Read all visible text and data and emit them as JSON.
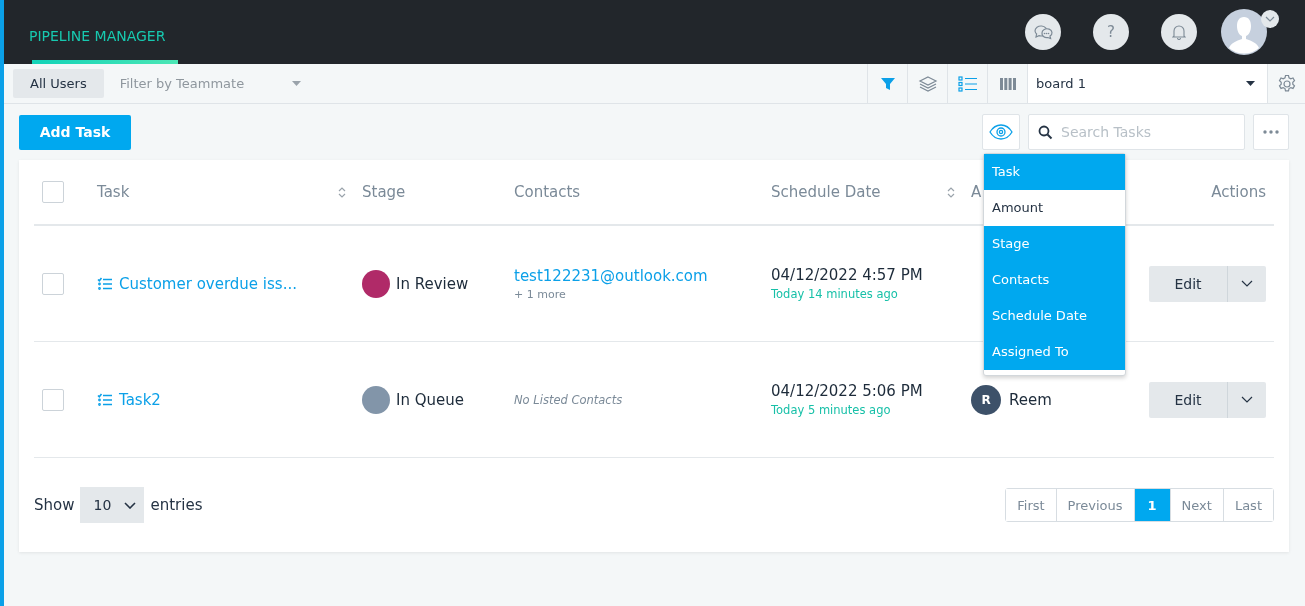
{
  "app": {
    "title": "PIPELINE MANAGER"
  },
  "header_buttons": [
    {
      "kind": "chat"
    },
    {
      "kind": "help",
      "label": "?"
    },
    {
      "kind": "bell"
    }
  ],
  "toolbar": {
    "tabs": [
      {
        "label": "All Users",
        "selected": true
      }
    ],
    "filter": {
      "placeholder": "Filter by Teammate"
    },
    "views": [
      {
        "kind": "filter",
        "selected": true
      },
      {
        "kind": "layers",
        "selected": false
      },
      {
        "kind": "list",
        "selected": true
      },
      {
        "kind": "columns",
        "selected": false
      }
    ],
    "board": {
      "value": "board 1"
    }
  },
  "add_button": "Add Task",
  "search": {
    "placeholder": "Search Tasks"
  },
  "column_menu": [
    {
      "label": "Task",
      "selected": true
    },
    {
      "label": "Amount",
      "selected": false
    },
    {
      "label": "Stage",
      "selected": true
    },
    {
      "label": "Contacts",
      "selected": true
    },
    {
      "label": "Schedule Date",
      "selected": true
    },
    {
      "label": "Assigned To",
      "selected": true
    }
  ],
  "table": {
    "select_all": {
      "checked": false
    },
    "columns": [
      {
        "label": "Task",
        "sortable": true
      },
      {
        "label": "Stage",
        "sortable": false
      },
      {
        "label": "Contacts",
        "sortable": false
      },
      {
        "label": "Schedule Date",
        "sortable": true
      },
      {
        "label": "A",
        "sortable": false
      },
      {
        "label": "Actions",
        "sortable": false
      }
    ],
    "rows": [
      {
        "checked": false,
        "task": "Customer overdue iss...",
        "stage": "In Review",
        "color": "#b02a68",
        "contact": "test122231@outlook.com",
        "contact_more": "+ 1 more",
        "date": "04/12/2022 4:57 PM",
        "ago": "Today 14 minutes ago",
        "action": "Edit"
      },
      {
        "checked": false,
        "task": "Task2",
        "stage": "In Queue",
        "color": "#8295a9",
        "no_contacts": "No Listed Contacts",
        "date": "04/12/2022 5:06 PM",
        "ago": "Today 5 minutes ago",
        "assignee": {
          "initial": "R",
          "name": "Reem"
        },
        "action": "Edit"
      }
    ]
  },
  "footer": {
    "show": "Show",
    "page_size": "10",
    "entries": "entries",
    "pagination": [
      {
        "label": "First",
        "selected": false
      },
      {
        "label": "Previous",
        "selected": false
      },
      {
        "label": "1",
        "selected": true
      },
      {
        "label": "Next",
        "selected": false
      },
      {
        "label": "Last",
        "selected": false
      }
    ]
  }
}
